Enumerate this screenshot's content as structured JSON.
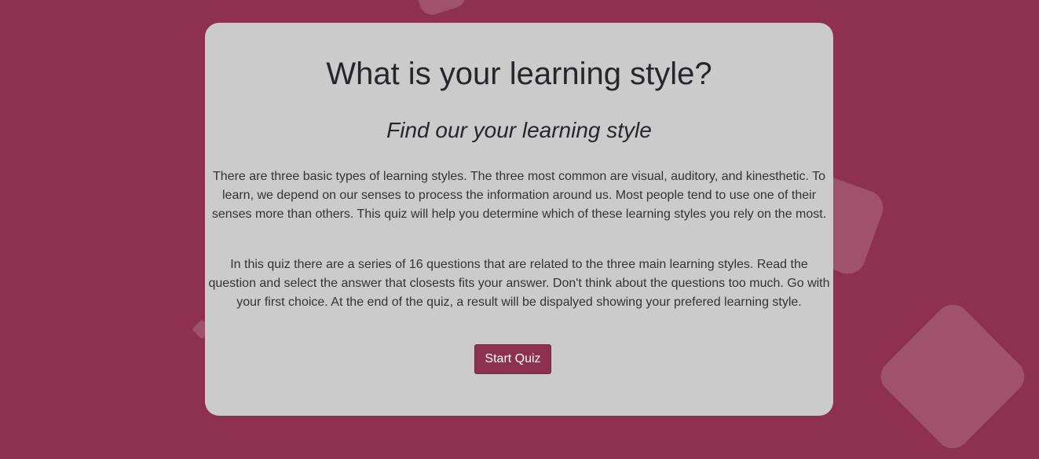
{
  "quiz_intro": {
    "title": "What is your learning style?",
    "subtitle": "Find our your learning style",
    "paragraph_1": "There are three basic types of learning styles. The three most common are visual, auditory, and kinesthetic. To learn, we depend on our senses to process the information around us. Most people tend to use one of their senses more than others. This quiz will help you determine which of these learning styles you rely on the most.",
    "paragraph_2": "In this quiz there are a series of 16 questions that are related to the three main learning styles. Read the question and select the answer that closests fits your answer. Don't think about the questions too much. Go with your first choice. At the end of the quiz, a result will be dispalyed showing your prefered learning style.",
    "start_button_label": "Start Quiz"
  },
  "colors": {
    "background": "#8e3150",
    "card": "#cbcbcb",
    "accent": "#8e3150"
  }
}
